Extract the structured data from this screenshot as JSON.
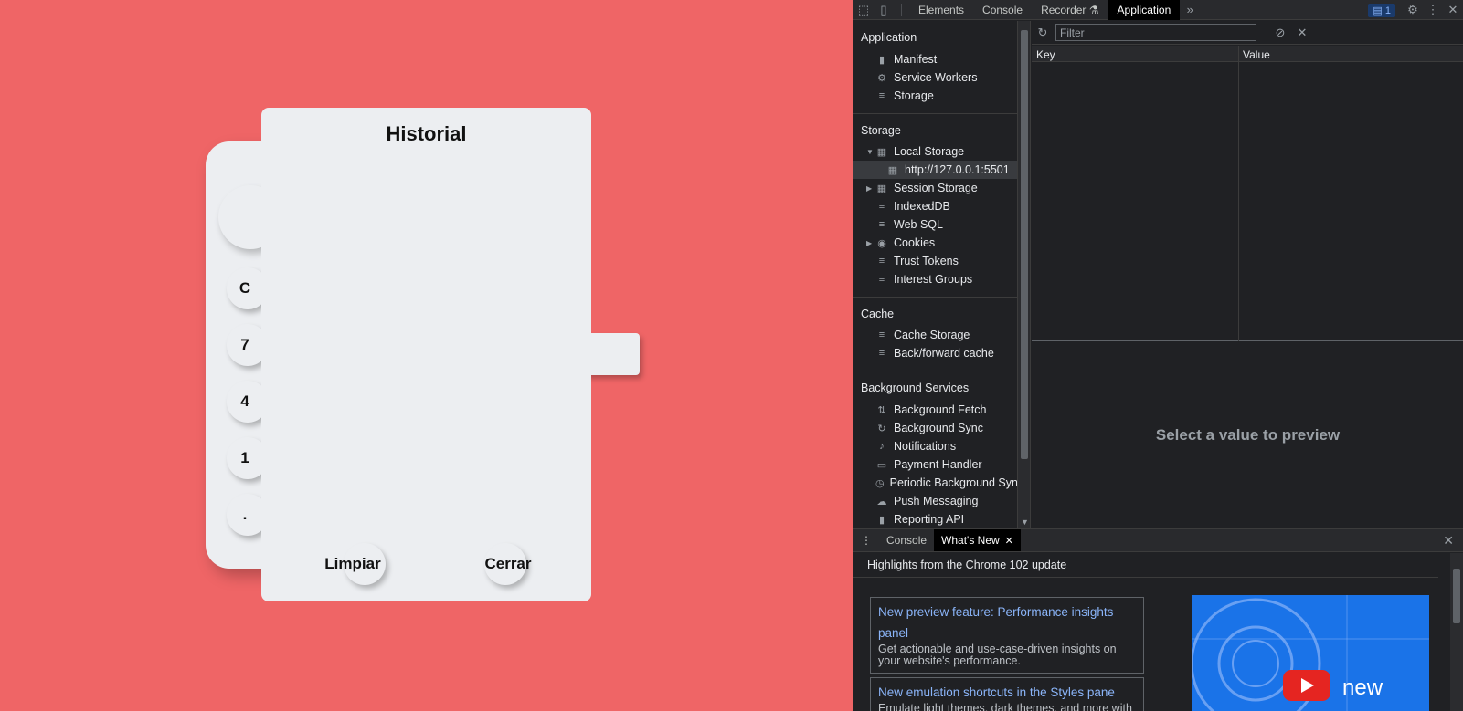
{
  "calculator": {
    "buttons": [
      "C",
      "7",
      "4",
      "1",
      "."
    ]
  },
  "history": {
    "title": "Historial",
    "clear_label": "Limpiar",
    "close_label": "Cerrar"
  },
  "devtools": {
    "tabs": [
      "Elements",
      "Console",
      "Recorder",
      "Application"
    ],
    "active_tab": "Application",
    "issues_count": "1",
    "sidebar": {
      "application": {
        "title": "Application",
        "items": [
          "Manifest",
          "Service Workers",
          "Storage"
        ]
      },
      "storage": {
        "title": "Storage",
        "items": [
          "Local Storage",
          "http://127.0.0.1:5501",
          "Session Storage",
          "IndexedDB",
          "Web SQL",
          "Cookies",
          "Trust Tokens",
          "Interest Groups"
        ]
      },
      "cache": {
        "title": "Cache",
        "items": [
          "Cache Storage",
          "Back/forward cache"
        ]
      },
      "background_services": {
        "title": "Background Services",
        "items": [
          "Background Fetch",
          "Background Sync",
          "Notifications",
          "Payment Handler",
          "Periodic Background Sync",
          "Push Messaging",
          "Reporting API"
        ]
      }
    },
    "filter_placeholder": "Filter",
    "grid": {
      "key_header": "Key",
      "value_header": "Value"
    },
    "preview_text": "Select a value to preview",
    "drawer": {
      "tabs": [
        "Console",
        "What's New"
      ],
      "active_tab": "What's New",
      "highlights": "Highlights from the Chrome 102 update",
      "cards": [
        {
          "title": "New preview feature: Performance insights panel",
          "desc": "Get actionable and use-case-driven insights on your website's performance."
        },
        {
          "title": "New emulation shortcuts in the Styles pane",
          "desc": "Emulate light themes, dark themes, and more with the render shortcut"
        }
      ],
      "video_text": "new"
    }
  }
}
